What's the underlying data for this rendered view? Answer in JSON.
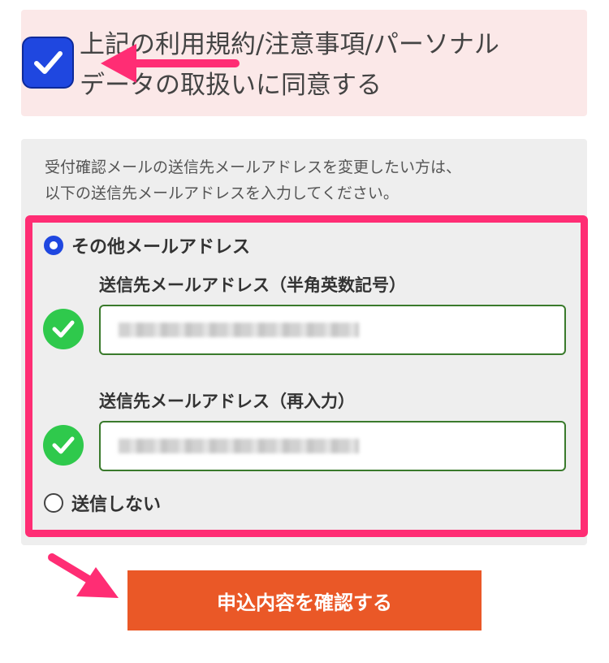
{
  "agreement": {
    "checked": true,
    "line1": "上記の利用規約/注意事項/パーソナル",
    "line2": "データの取扱いに同意する"
  },
  "notification": {
    "description_line1": "受付確認メールの送信先メールアドレスを変更したい方は、",
    "description_line2": "以下の送信先メールアドレスを入力してください。",
    "options": [
      {
        "label": "その他メールアドレス",
        "selected": true
      },
      {
        "label": "送信しない",
        "selected": false
      }
    ],
    "email_label": "送信先メールアドレス（半角英数記号）",
    "email_confirm_label": "送信先メールアドレス（再入力）"
  },
  "submit": {
    "label": "申込内容を確認する"
  },
  "colors": {
    "accent_blue": "#1f47e0",
    "highlight_pink": "#ff2d74",
    "submit_orange": "#ea5827",
    "valid_green": "#2fc94c"
  },
  "icons": [
    "checkbox-checked-icon",
    "radio-selected-icon",
    "radio-unselected-icon",
    "valid-check-icon",
    "pointer-arrow-icon"
  ]
}
